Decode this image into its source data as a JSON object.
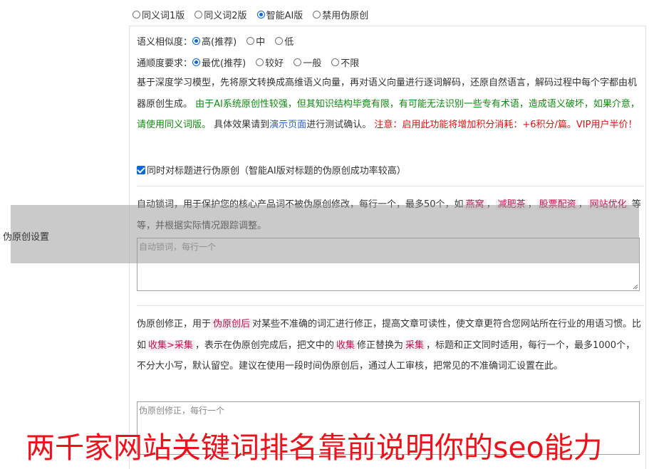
{
  "version_options": {
    "items": [
      "同义词1版",
      "同义词2版",
      "智能AI版",
      "禁用伪原创"
    ],
    "selected_index": 2
  },
  "similarity": {
    "label": "语义相似度：",
    "options": [
      "高(推荐)",
      "中",
      "低"
    ],
    "selected_index": 0
  },
  "fluency": {
    "label": "通顺度要求：",
    "options": [
      "最优(推荐)",
      "较好",
      "一般",
      "不限"
    ],
    "selected_index": 0
  },
  "description": {
    "part1": "基于深度学习模型，先将原文转换成高维语义向量，再对语义向量进行逐词解码，还原自然语言，解码过程中每个字都由机器原创生成。",
    "part2_green": "由于AI系统原创性较强，但其知识结构毕竟有限，有可能无法识别一些专有术语，造成语义破坏，如果介意，请使用同义词版。",
    "part3": "具体效果请到",
    "demo_link": "演示页面",
    "part4": "进行测试确认。",
    "warning_red": "注意：启用此功能将增加积分消耗：+6积分/篇。VIP用户半价！"
  },
  "title_checkbox": {
    "label": "同时对标题进行伪原创（智能AI版对标题的伪原创成功率较高）",
    "checked": true
  },
  "side_label": "伪原创设置",
  "lock_words": {
    "text1": "自动锁词，用于保护您的核心产品词不被伪原创修改，每行一个，最多50个，如",
    "examples": [
      "燕窝",
      "减肥茶",
      "股票配资",
      "网站优化"
    ],
    "text2": "等等，并根据实际情况跟踪调整。",
    "placeholder": "自动锁词，每行一个"
  },
  "correction": {
    "text1": "伪原创修正，用于",
    "tag1": "伪原创后",
    "text2": "对某些不准确的词汇进行修正，提高文章可读性，使文章更符合您网站所在行业的用语习惯。比如",
    "tag2": "收集>采集",
    "text3": "，表示在伪原创完成后，把文中的",
    "tag3": "收集",
    "text4": "修正替换为",
    "tag4": "采集",
    "text5": "，标题和正文同时适用，每行一个，最多1000个，不分大小写，默认留空。建议在使用一段时间伪原创后，通过人工审核，把常见的不准确词汇设置在此。",
    "placeholder": "伪原创修正，每行一个"
  },
  "banner": "两千家网站关键词排名靠前说明你的seo能力",
  "colors": {
    "accent": "#0b68d8",
    "green": "#0f8a0f",
    "red": "#e01010",
    "banner": "#f0101a"
  }
}
